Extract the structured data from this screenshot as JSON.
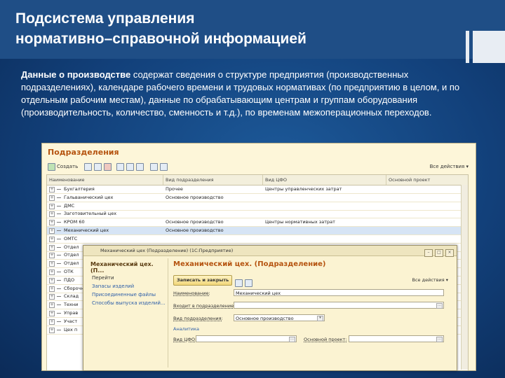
{
  "slide": {
    "title_line1": "Подсистема управления",
    "title_line2": "нормативно–справочной информацией",
    "body_bold": "Данные о производстве",
    "body_rest": " содержат сведения о структуре предприятия (производственных подразделениях), календаре рабочего времени и трудовых нормативах (по предприятию в целом, и по отдельным рабочим местам), данные по обрабатывающим центрам и группам оборудования (производительность, количество, сменность и т.д.), по временам межоперационных переходов."
  },
  "list_window": {
    "title": "Подразделения",
    "toolbar": {
      "create": "Создать",
      "actions": "Все действия ▾"
    },
    "columns": [
      "Наименование",
      "Вид подразделения",
      "Вид ЦФО",
      "Основной проект"
    ],
    "rows": [
      {
        "name": "Бухгалтерия",
        "kind": "Прочее",
        "cfo": "Центры управленческих затрат"
      },
      {
        "name": "Гальванический цех",
        "kind": "Основное производство",
        "cfo": ""
      },
      {
        "name": "ДМС",
        "kind": "",
        "cfo": ""
      },
      {
        "name": "Заготовительный цех",
        "kind": "",
        "cfo": ""
      },
      {
        "name": "КРОМ 60",
        "kind": "Основное производство",
        "cfo": "Центры нормативных затрат"
      },
      {
        "name": "Механический цех",
        "kind": "Основное производство",
        "cfo": ""
      },
      {
        "name": "ОМТС",
        "kind": "",
        "cfo": ""
      },
      {
        "name": "Отдел",
        "kind": "",
        "cfo": ""
      },
      {
        "name": "Отдел",
        "kind": "",
        "cfo": ""
      },
      {
        "name": "Отдел",
        "kind": "",
        "cfo": ""
      },
      {
        "name": "ОТК",
        "kind": "",
        "cfo": ""
      },
      {
        "name": "ПДО",
        "kind": "",
        "cfo": ""
      },
      {
        "name": "Сборочный",
        "kind": "",
        "cfo": ""
      },
      {
        "name": "Склад",
        "kind": "",
        "cfo": ""
      },
      {
        "name": "Техни",
        "kind": "",
        "cfo": ""
      },
      {
        "name": "Управ",
        "kind": "",
        "cfo": ""
      },
      {
        "name": "Участ",
        "kind": "",
        "cfo": ""
      },
      {
        "name": "Цех п",
        "kind": "",
        "cfo": ""
      }
    ],
    "selected_index": 5
  },
  "dialog": {
    "window_title": "Механический цех (Подразделение) (1С:Предприятие)",
    "left_title": "Механический цех. (П...",
    "left_links": [
      "Перейти",
      "Запасы изделий",
      "Присоединенные файлы",
      "Способы выпуска изделий..."
    ],
    "form_title": "Механический цех. (Подразделение)",
    "save_close": "Записать и закрыть",
    "actions": "Все действия ▾",
    "fields": {
      "name_label": "Наименование:",
      "name_value": "Механический цех",
      "parent_label": "Входит в подразделение:",
      "parent_value": "",
      "kind_label": "Вид подразделения:",
      "kind_value": "Основное производство",
      "analytics": "Аналитика",
      "cfo_label": "Вид ЦФО:",
      "cfo_value": "",
      "project_label": "Основной проект:",
      "project_value": ""
    }
  },
  "colors": {
    "bg_dark": "#0b2b58",
    "bg_mid": "#1d5a9a",
    "band": "#1f4e86",
    "window_bg": "#fdf6d9",
    "orange_title": "#b5530f"
  }
}
